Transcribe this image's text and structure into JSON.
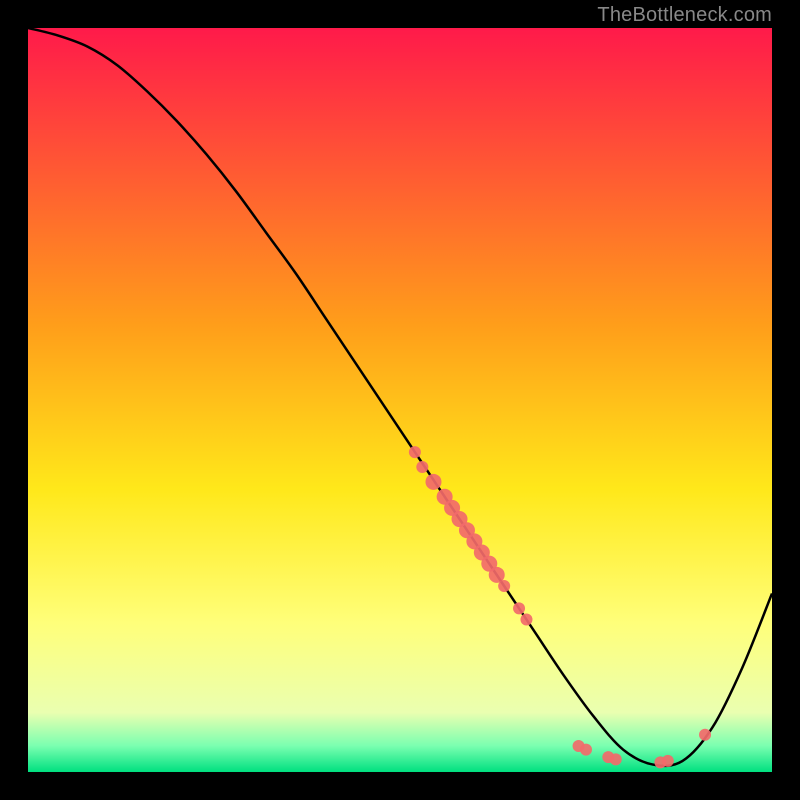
{
  "watermark": "TheBottleneck.com",
  "chart_data": {
    "type": "line",
    "title": "",
    "xlabel": "",
    "ylabel": "",
    "xlim": [
      0,
      100
    ],
    "ylim": [
      0,
      100
    ],
    "background_gradient": {
      "stops": [
        {
          "offset": 0.0,
          "color": "#ff1a4a"
        },
        {
          "offset": 0.4,
          "color": "#ff9e1a"
        },
        {
          "offset": 0.62,
          "color": "#ffe81a"
        },
        {
          "offset": 0.8,
          "color": "#ffff7a"
        },
        {
          "offset": 0.92,
          "color": "#eaffb0"
        },
        {
          "offset": 0.965,
          "color": "#7affb0"
        },
        {
          "offset": 1.0,
          "color": "#00e080"
        }
      ]
    },
    "series": [
      {
        "name": "bottleneck-curve",
        "x": [
          0,
          4,
          8,
          12,
          16,
          20,
          24,
          28,
          32,
          36,
          40,
          44,
          48,
          52,
          56,
          60,
          64,
          68,
          72,
          76,
          80,
          84,
          88,
          92,
          96,
          100
        ],
        "y": [
          100,
          99,
          97.5,
          95,
          91.5,
          87.5,
          83,
          78,
          72.5,
          67,
          61,
          55,
          49,
          43,
          37,
          31,
          25,
          19,
          13,
          7.5,
          3,
          1,
          1.5,
          6,
          14,
          24
        ]
      }
    ],
    "scatter_points": {
      "name": "highlight-dots",
      "color": "#f26a6a",
      "points": [
        {
          "x": 52,
          "y": 43,
          "r": 6
        },
        {
          "x": 53,
          "y": 41,
          "r": 6
        },
        {
          "x": 54.5,
          "y": 39,
          "r": 8
        },
        {
          "x": 56,
          "y": 37,
          "r": 8
        },
        {
          "x": 57,
          "y": 35.5,
          "r": 8
        },
        {
          "x": 58,
          "y": 34,
          "r": 8
        },
        {
          "x": 59,
          "y": 32.5,
          "r": 8
        },
        {
          "x": 60,
          "y": 31,
          "r": 8
        },
        {
          "x": 61,
          "y": 29.5,
          "r": 8
        },
        {
          "x": 62,
          "y": 28,
          "r": 8
        },
        {
          "x": 63,
          "y": 26.5,
          "r": 8
        },
        {
          "x": 64,
          "y": 25,
          "r": 6
        },
        {
          "x": 66,
          "y": 22,
          "r": 6
        },
        {
          "x": 67,
          "y": 20.5,
          "r": 6
        },
        {
          "x": 74,
          "y": 3.5,
          "r": 6
        },
        {
          "x": 75,
          "y": 3,
          "r": 6
        },
        {
          "x": 78,
          "y": 2,
          "r": 6
        },
        {
          "x": 79,
          "y": 1.7,
          "r": 6
        },
        {
          "x": 85,
          "y": 1.3,
          "r": 6
        },
        {
          "x": 86,
          "y": 1.5,
          "r": 6
        },
        {
          "x": 91,
          "y": 5,
          "r": 6
        }
      ]
    }
  }
}
